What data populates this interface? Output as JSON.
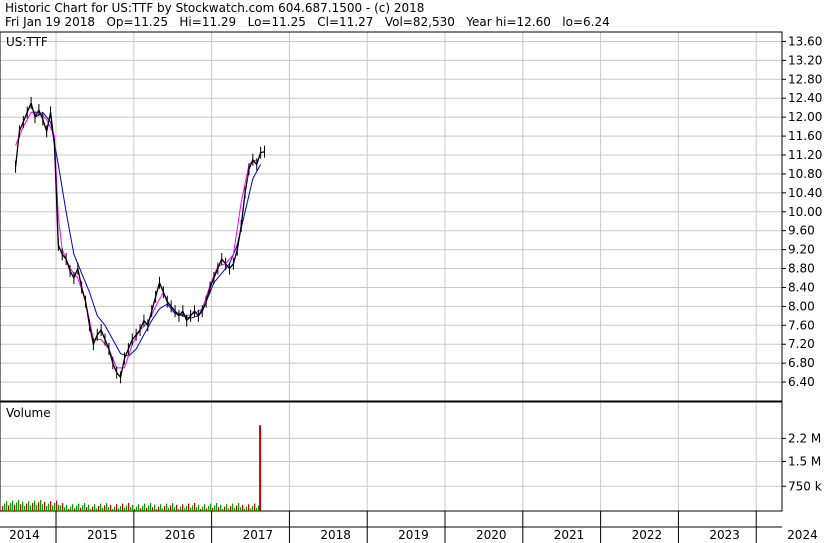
{
  "header": {
    "line1": "Historic Chart for US:TTF by Stockwatch.com 604.687.1500 - (c) 2018",
    "line2": "Fri Jan 19 2018   Op=11.25   Hi=11.29   Lo=11.25   Cl=11.27   Vol=82,530   Year hi=12.60   lo=6.24"
  },
  "colors": {
    "price": "#000000",
    "ma_fast": "#ff00ff",
    "ma_slow": "#0000cc",
    "vol_up": "#00a000",
    "vol_down": "#cc0000",
    "grid": "#c8c8c8"
  },
  "chart_data": [
    {
      "type": "line",
      "title": "US:TTF",
      "ylim": [
        6.0,
        13.8
      ],
      "yticks": [
        "13.60",
        "13.20",
        "12.80",
        "12.40",
        "12.00",
        "11.60",
        "11.20",
        "10.80",
        "10.40",
        "10.00",
        "9.60",
        "9.20",
        "8.80",
        "8.40",
        "8.00",
        "7.60",
        "7.20",
        "6.80",
        "6.40"
      ],
      "x_labels": [
        "2014",
        "2015",
        "2016",
        "2017",
        "2018",
        "2019",
        "2020",
        "2021",
        "2022",
        "2023",
        "2024"
      ],
      "grid": true,
      "series": [
        {
          "key": "close",
          "x": [
            2013.95,
            2014.0,
            2014.05,
            2014.1,
            2014.15,
            2014.2,
            2014.25,
            2014.3,
            2014.35,
            2014.4,
            2014.45,
            2014.5,
            2014.55,
            2014.6,
            2014.65,
            2014.7,
            2014.75,
            2014.8,
            2014.85,
            2014.9,
            2014.95,
            2015.0,
            2015.05,
            2015.1,
            2015.15,
            2015.2,
            2015.25,
            2015.3,
            2015.35,
            2015.4,
            2015.45,
            2015.5,
            2015.55,
            2015.6,
            2015.65,
            2015.7,
            2015.75,
            2015.8,
            2015.85,
            2015.9,
            2015.95,
            2016.0,
            2016.05,
            2016.1,
            2016.15,
            2016.2,
            2016.25,
            2016.3,
            2016.35,
            2016.4,
            2016.45,
            2016.5,
            2016.55,
            2016.6,
            2016.65,
            2016.7,
            2016.75,
            2016.8,
            2016.85,
            2016.9,
            2016.95,
            2017.0,
            2017.05,
            2017.1,
            2017.15,
            2017.2,
            2017.25,
            2017.3,
            2017.35,
            2017.4,
            2017.45,
            2017.5,
            2017.55,
            2017.6,
            2017.65,
            2017.7,
            2017.75,
            2017.8,
            2017.85,
            2017.9,
            2017.95,
            2018.0,
            2018.05
          ],
          "values": [
            10.95,
            11.7,
            11.9,
            12.1,
            12.3,
            12.0,
            12.15,
            11.95,
            11.7,
            12.1,
            11.4,
            9.3,
            9.1,
            9.0,
            8.75,
            8.6,
            8.8,
            8.4,
            8.1,
            7.6,
            7.2,
            7.4,
            7.5,
            7.3,
            7.1,
            6.8,
            6.6,
            6.5,
            6.9,
            7.1,
            7.3,
            7.4,
            7.5,
            7.7,
            7.6,
            7.9,
            8.2,
            8.5,
            8.3,
            8.1,
            8.0,
            7.9,
            7.8,
            7.9,
            7.7,
            7.8,
            7.9,
            7.8,
            7.9,
            8.1,
            8.4,
            8.6,
            8.8,
            9.0,
            8.9,
            8.8,
            8.9,
            9.2,
            9.7,
            10.4,
            10.9,
            11.1,
            11.0,
            11.25,
            11.27,
            null,
            null,
            null,
            null,
            null,
            null,
            null,
            null,
            null,
            null,
            null,
            null,
            null,
            null,
            null,
            null,
            null,
            null
          ]
        },
        {
          "key": "ma_fast",
          "x": [
            2013.95,
            2014.05,
            2014.15,
            2014.25,
            2014.35,
            2014.45,
            2014.5,
            2014.55,
            2014.65,
            2014.75,
            2014.85,
            2014.95,
            2015.05,
            2015.15,
            2015.25,
            2015.35,
            2015.45,
            2015.55,
            2015.65,
            2015.75,
            2015.85,
            2015.95,
            2016.05,
            2016.15,
            2016.25,
            2016.35,
            2016.45,
            2016.55,
            2016.65,
            2016.75,
            2016.85,
            2016.95,
            2017.05
          ],
          "values": [
            11.4,
            11.8,
            12.1,
            12.1,
            11.95,
            11.6,
            9.9,
            9.2,
            8.8,
            8.6,
            8.1,
            7.3,
            7.3,
            7.1,
            6.7,
            6.7,
            7.2,
            7.5,
            7.65,
            8.0,
            8.3,
            7.95,
            7.85,
            7.8,
            7.85,
            7.95,
            8.45,
            8.85,
            8.9,
            9.1,
            10.2,
            11.0,
            11.1
          ]
        },
        {
          "key": "ma_slow",
          "x": [
            2014.2,
            2014.3,
            2014.4,
            2014.5,
            2014.6,
            2014.7,
            2014.8,
            2014.9,
            2015.0,
            2015.1,
            2015.2,
            2015.3,
            2015.4,
            2015.5,
            2015.6,
            2015.7,
            2015.8,
            2015.9,
            2016.0,
            2016.1,
            2016.2,
            2016.3,
            2016.4,
            2016.5,
            2016.6,
            2016.7,
            2016.8,
            2016.9,
            2017.0,
            2017.1
          ],
          "values": [
            12.0,
            12.1,
            11.9,
            11.0,
            10.0,
            9.1,
            8.7,
            8.3,
            7.8,
            7.6,
            7.3,
            7.0,
            6.95,
            7.1,
            7.4,
            7.7,
            7.95,
            8.05,
            7.85,
            7.8,
            7.75,
            7.8,
            8.1,
            8.5,
            8.7,
            8.9,
            9.3,
            10.0,
            10.7,
            11.0
          ]
        }
      ]
    },
    {
      "type": "bar",
      "title": "Volume",
      "ylim": [
        0,
        3000000
      ],
      "yticks": [
        "2.2 M",
        "1.5 M",
        "750 k"
      ],
      "ytick_values": [
        2200000,
        1500000,
        750000
      ],
      "annotations": [
        {
          "x": 2017.08,
          "value": 2600000,
          "color": "vol_down"
        }
      ]
    }
  ]
}
